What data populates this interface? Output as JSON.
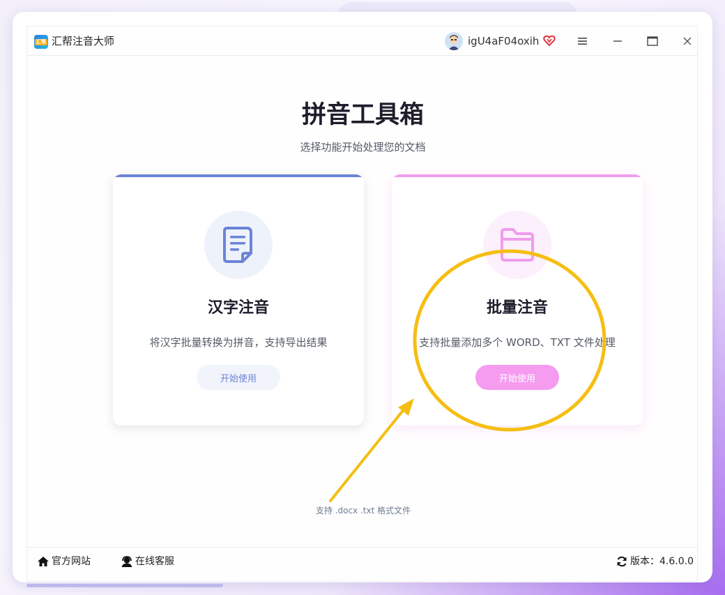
{
  "app": {
    "title": "汇帮注音大师",
    "logo_text": "汇帮"
  },
  "header": {
    "username": "igU4aF04oxih",
    "menu_icon": "hamburger-menu-icon",
    "minimize_icon": "minimize-icon",
    "maximize_icon": "maximize-icon",
    "close_icon": "close-icon"
  },
  "main": {
    "title": "拼音工具箱",
    "subtitle": "选择功能开始处理您的文档",
    "cards": [
      {
        "title": "汉字注音",
        "description": "将汉字批量转换为拼音，支持导出结果",
        "button_label": "开始使用",
        "icon": "document-icon",
        "accent": "#6c84d6"
      },
      {
        "title": "批量注音",
        "description": "支持批量添加多个 WORD、TXT 文件处理",
        "button_label": "开始使用",
        "icon": "folder-icon",
        "accent": "#f09ded"
      }
    ],
    "format_note": "支持 .docx .txt 格式文件"
  },
  "footer": {
    "official_site": "官方网站",
    "online_service": "在线客服",
    "version": "版本：4.6.0.0"
  },
  "colors": {
    "highlight_annotation": "#f5be12"
  }
}
